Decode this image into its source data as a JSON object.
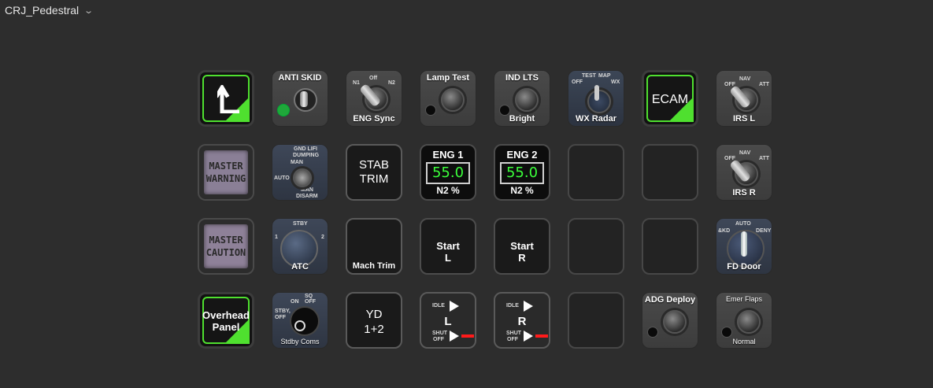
{
  "profile": {
    "name": "CRJ_Pedestral",
    "chevron_icon": "chevron-down-icon"
  },
  "keys": {
    "back": {
      "icon": "back-arrow-icon"
    },
    "anti_skid": {
      "label": "ANTI SKID"
    },
    "eng_sync": {
      "label": "ENG Sync",
      "pos_n1": "N1",
      "pos_off": "Off",
      "pos_n2": "N2"
    },
    "lamp_test": {
      "label": "Lamp Test"
    },
    "ind_lts": {
      "label_top": "IND LTS",
      "label_bottom": "Bright"
    },
    "wx_radar": {
      "label": "WX Radar",
      "pos_test": "TEST",
      "pos_map": "MAP",
      "pos_off": "OFF",
      "pos_wx": "WX"
    },
    "ecam": {
      "label": "ECAM"
    },
    "irs_l": {
      "label": "IRS L",
      "pos_off": "OFF",
      "pos_nav": "NAV",
      "pos_att": "ATT"
    },
    "master_warning": {
      "line1": "MASTER",
      "line2": "WARNING"
    },
    "dump": {
      "pos1": "GND LIFI",
      "pos2": "DUMPING",
      "pos3": "MAN",
      "pos4": "AUTO",
      "pos5": "MAN",
      "pos6": "DISARM"
    },
    "stab_trim": {
      "line1": "STAB",
      "line2": "TRIM"
    },
    "eng1": {
      "title": "ENG 1",
      "value": "55.0",
      "unit": "N2  %"
    },
    "eng2": {
      "title": "ENG 2",
      "value": "55.0",
      "unit": "N2  %"
    },
    "irs_r": {
      "label": "IRS R",
      "pos_off": "OFF",
      "pos_nav": "NAV",
      "pos_att": "ATT"
    },
    "master_caution": {
      "line1": "MASTER",
      "line2": "CAUTION"
    },
    "atc": {
      "label": "ATC",
      "pos_stby": "STBY",
      "pos_1": "1",
      "pos_2": "2"
    },
    "mach_trim": {
      "label": "Mach Trim"
    },
    "start_l": {
      "line1": "Start",
      "line2": "L"
    },
    "start_r": {
      "line1": "Start",
      "line2": "R"
    },
    "fd_door": {
      "label": "FD Door",
      "pos_auto": "AUTO",
      "pos_lkd": "&KD",
      "pos_deny": "DENY"
    },
    "overhead": {
      "line1": "Overhead",
      "line2": "Panel"
    },
    "stdby_coms": {
      "label": "Stdby Coms",
      "pos_sq": "SQ",
      "pos_on": "ON",
      "pos_off": "OFF",
      "pos_stby": "STBY,",
      "pos_off2": "OFF"
    },
    "yd": {
      "line1": "YD",
      "line2": "1+2"
    },
    "thr_l": {
      "idle": "IDLE",
      "shut": "SHUT",
      "off": "OFF",
      "side": "L"
    },
    "thr_r": {
      "idle": "IDLE",
      "shut": "SHUT",
      "off": "OFF",
      "side": "R"
    },
    "adg": {
      "label": "ADG Deploy"
    },
    "emer_flaps": {
      "label_top": "Emer Flaps",
      "label_bottom": "Normal"
    }
  },
  "colors": {
    "green": "#4fe02f",
    "digits": "#3bff3b",
    "red": "#ff1a1a"
  }
}
